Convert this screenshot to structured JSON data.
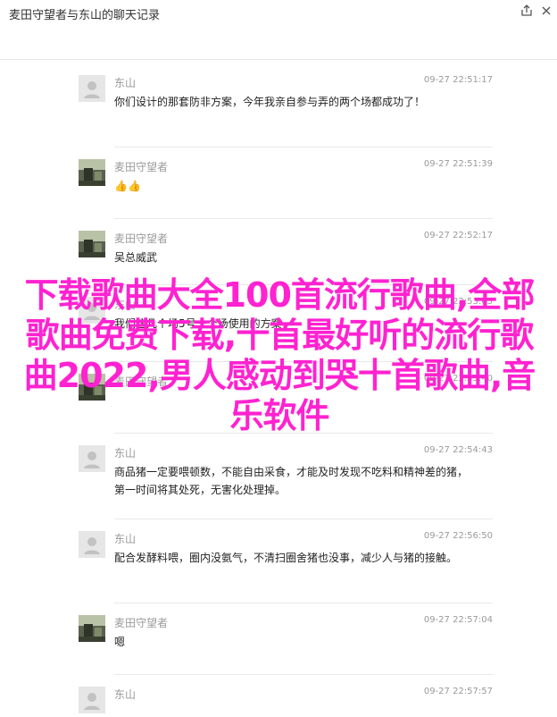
{
  "window": {
    "title": "麦田守望者与东山的聊天记录",
    "share_icon": "share-icon",
    "close_icon": "close-icon"
  },
  "messages": [
    {
      "sender": "东山",
      "time": "09-27 22:51:17",
      "avatar": "gray-avatar",
      "text": "你们设计的那套防非方案，今年我亲自参与弄的两个场都成功了！"
    },
    {
      "sender": "麦田守望者",
      "time": "09-27 22:51:39",
      "avatar": "photo-avatar",
      "text": "👍👍"
    },
    {
      "sender": "麦田守望者",
      "time": "09-27 22:52:17",
      "avatar": "photo-avatar",
      "text": "吴总威武"
    },
    {
      "sender": "东山",
      "time": "09-27 22:53:05",
      "avatar": "gray-avatar",
      "text": "我们这几个场5号一个场使用的方案"
    },
    {
      "sender": "麦田守望者",
      "time": "09-27 22:53:40",
      "avatar": "photo-avatar",
      "text": ""
    },
    {
      "sender": "东山",
      "time": "09-27 22:54:43",
      "avatar": "gray-avatar",
      "text": "商品猪一定要喂顿数，不能自由采食，才能及时发现不吃料和精神差的猪，第一时间将其处死，无害化处理掉。"
    },
    {
      "sender": "东山",
      "time": "09-27 22:56:50",
      "avatar": "gray-avatar",
      "text": "配合发酵料喂，圈内没氨气，不清扫圈舍猪也没事，减少人与猪的接触。"
    },
    {
      "sender": "麦田守望者",
      "time": "09-27 22:57:04",
      "avatar": "photo-avatar",
      "text": "嗯"
    },
    {
      "sender": "东山",
      "time": "09-27 22:57:57",
      "avatar": "gray-avatar",
      "text": ""
    }
  ],
  "overlay": {
    "text": "下载歌曲大全100首流行歌曲,全部歌曲免费下载,十首最好听的流行歌曲2022,男人感动到哭十首歌曲,音乐软件"
  }
}
